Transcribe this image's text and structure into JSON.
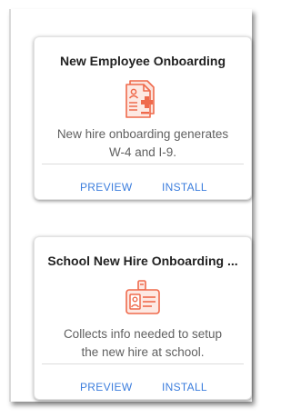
{
  "cards": [
    {
      "title": "New Employee Onboarding",
      "icon": "document-medical-icon",
      "description_lines": [
        "New hire onboarding generates",
        "W-4 and I-9."
      ],
      "actions": {
        "preview": "PREVIEW",
        "install": "INSTALL"
      }
    },
    {
      "title": "School New Hire Onboarding ...",
      "icon": "id-badge-icon",
      "description_lines": [
        "Collects info needed to setup",
        "the new hire at school."
      ],
      "actions": {
        "preview": "PREVIEW",
        "install": "INSTALL"
      }
    }
  ],
  "colors": {
    "icon_accent": "#ef6a4c",
    "link": "#3b7ddd"
  }
}
